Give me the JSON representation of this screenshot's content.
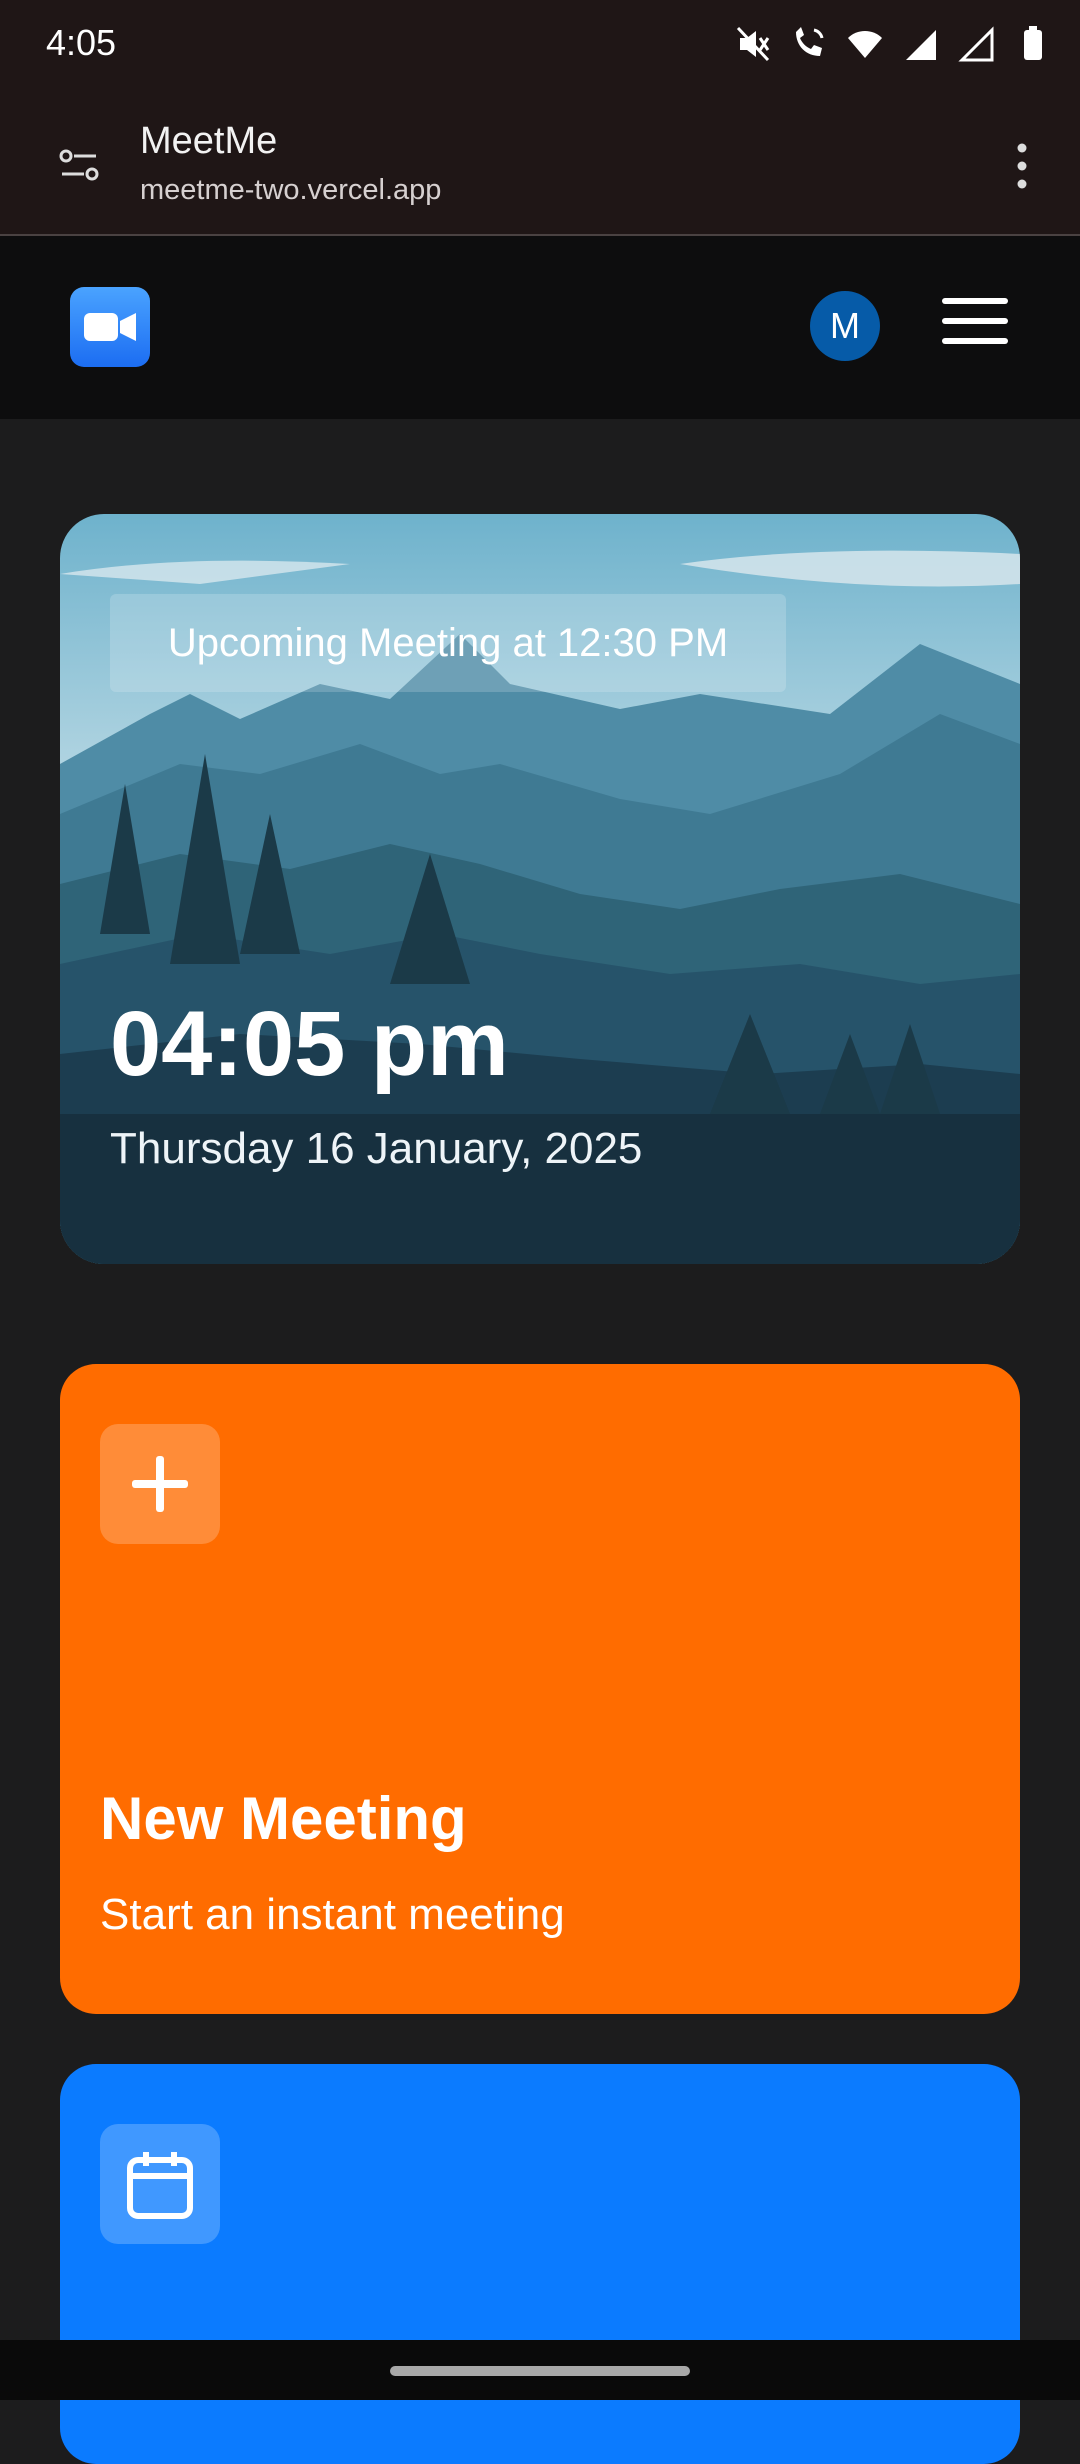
{
  "status_bar": {
    "time": "4:05",
    "icons": [
      "mute-icon",
      "wifi-call-icon",
      "wifi-icon",
      "signal-icon",
      "signal-icon",
      "battery-icon"
    ]
  },
  "browser": {
    "site_title": "MeetMe",
    "url": "meetme-two.vercel.app"
  },
  "header": {
    "logo_icon": "video-camera-icon",
    "avatar_initial": "M",
    "menu_icon": "hamburger-menu-icon"
  },
  "hero": {
    "upcoming": "Upcoming Meeting at 12:30 PM",
    "time": "04:05 pm",
    "date": "Thursday 16 January, 2025"
  },
  "cards": [
    {
      "icon": "plus-icon",
      "title": "New Meeting",
      "subtitle": "Start an instant meeting",
      "color": "#ff6c00"
    },
    {
      "icon": "calendar-icon",
      "color": "#0b7bff"
    }
  ]
}
